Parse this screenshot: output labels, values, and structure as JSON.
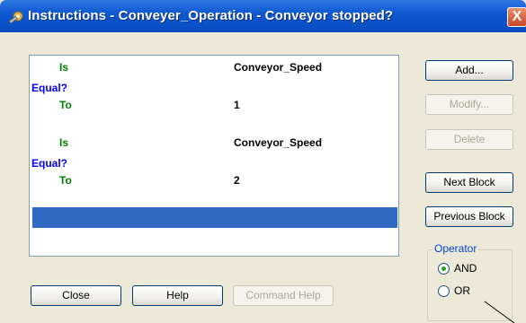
{
  "window": {
    "title": "Instructions - Conveyer_Operation - Conveyor stopped?",
    "close_glyph": "X",
    "title_icon": "wrench-gear-icon"
  },
  "instructions": [
    {
      "keyword": "Is",
      "operator": "Equal?",
      "operand": "Conveyor_Speed",
      "to_label": "To",
      "value": "1"
    },
    {
      "keyword": "Is",
      "operator": "Equal?",
      "operand": "Conveyor_Speed",
      "to_label": "To",
      "value": "2"
    }
  ],
  "buttons": {
    "add": "Add...",
    "modify": "Modify...",
    "delete": "Delete",
    "next_block": "Next Block",
    "previous_block": "Previous Block",
    "close": "Close",
    "help": "Help",
    "command_help": "Command Help"
  },
  "operator_group": {
    "label": "Operator",
    "options": [
      "AND",
      "OR"
    ],
    "selected": "AND"
  },
  "colors": {
    "keyword": "#008000",
    "operator": "#0000ff",
    "selection": "#316ac5",
    "titlebar": "#0a4fc6"
  }
}
